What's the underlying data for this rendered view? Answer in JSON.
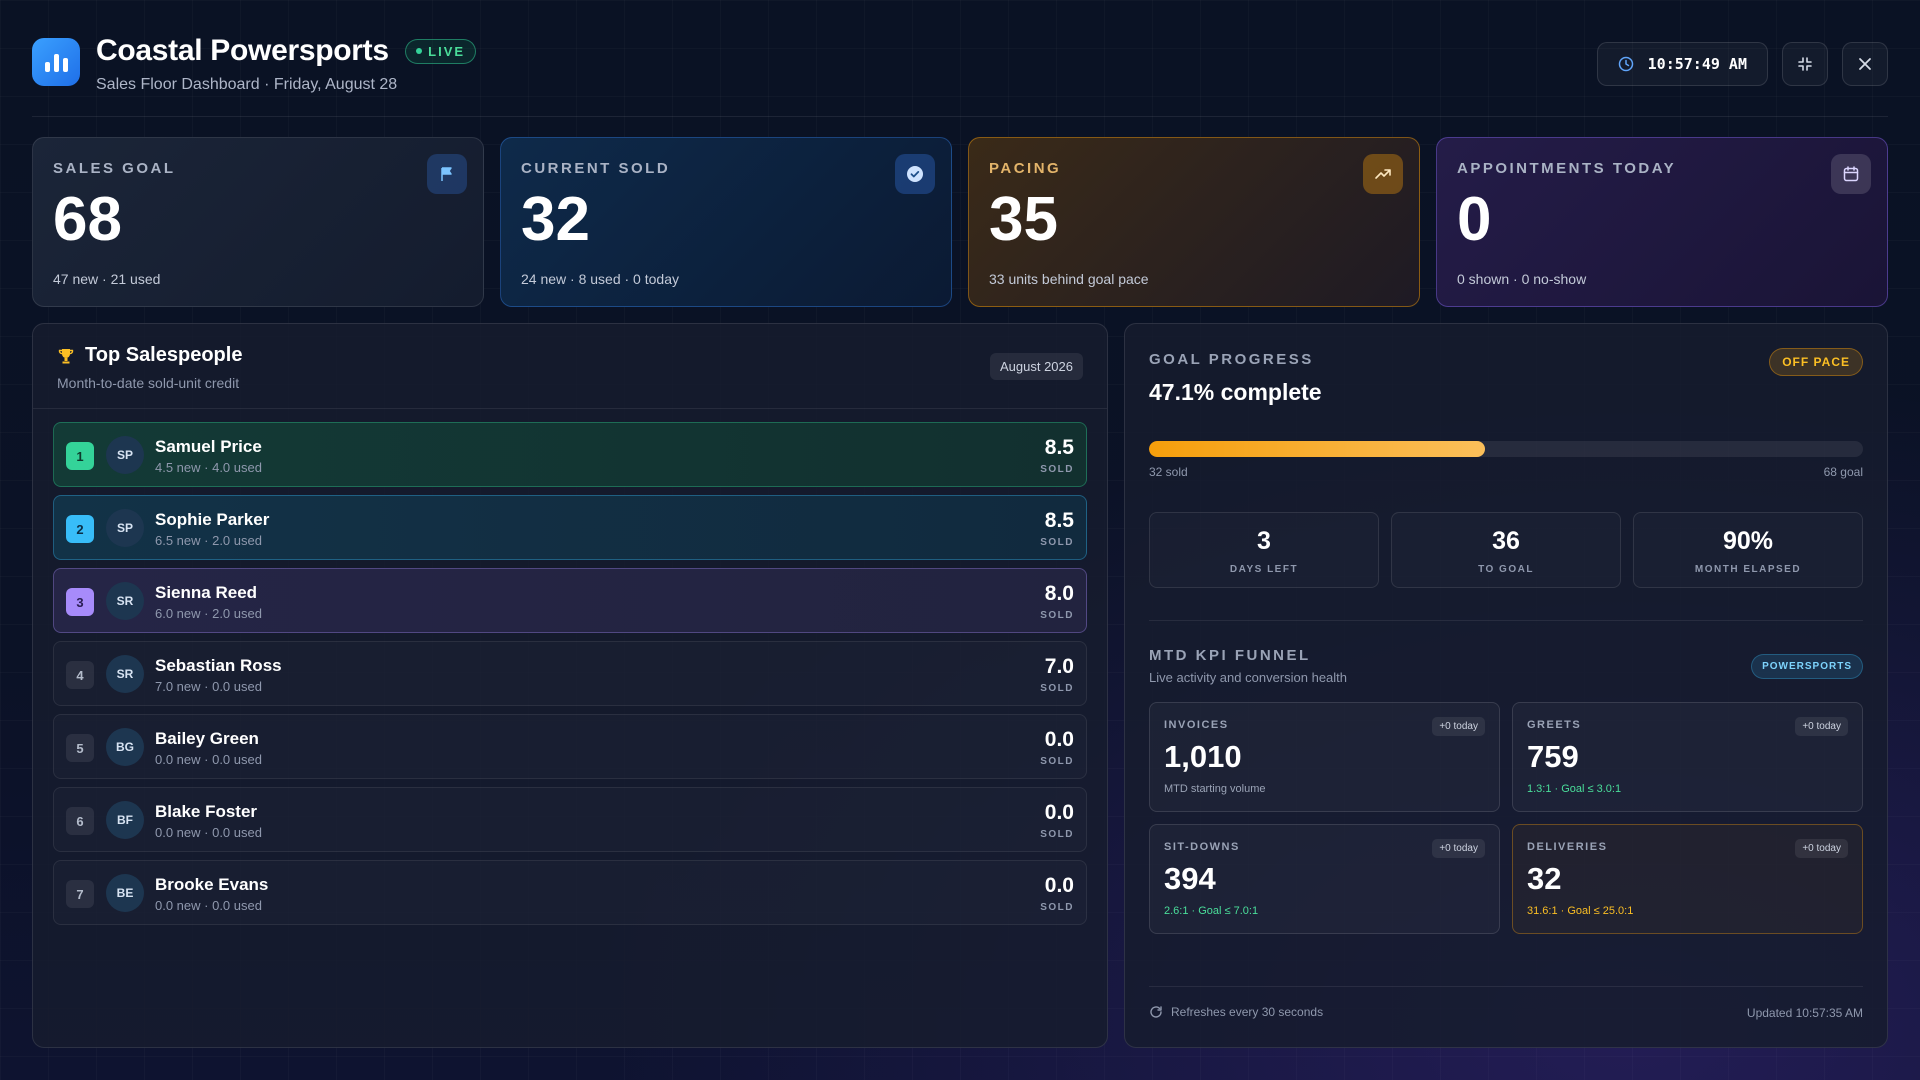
{
  "app": {
    "title": "Coastal Powersports",
    "live_label": "LIVE",
    "subtitle": "Sales Floor Dashboard · Friday, August 28",
    "clock": "10:57:49 AM"
  },
  "icons": {
    "logo": "bar-chart-icon",
    "clock": "clock-icon",
    "collapse": "collapse-icon",
    "close": "close-icon",
    "goal": "flag-icon",
    "sold": "check-circle-icon",
    "pacing": "trending-up-icon",
    "appointments": "calendar-icon",
    "salespeople": "trophy-icon",
    "refresh": "refresh-icon"
  },
  "colors": {
    "accent_blue": "#3aa0ff",
    "live_green": "#34d399",
    "pace_amber": "#f59e0b",
    "appt_purple": "#8b6cff"
  },
  "kpis": {
    "goal": {
      "label": "SALES GOAL",
      "value": "68",
      "sub": "47 new · 21 used"
    },
    "sold": {
      "label": "CURRENT SOLD",
      "value": "32",
      "sub": "24 new · 8 used · 0 today"
    },
    "pacing": {
      "label": "PACING",
      "value": "35",
      "sub": "33 units behind goal pace"
    },
    "appointments": {
      "label": "APPOINTMENTS TODAY",
      "value": "0",
      "sub": "0 shown · 0 no-show"
    }
  },
  "salespeople": {
    "title": "Top Salespeople",
    "subtitle": "Month-to-date sold-unit credit",
    "month": "August 2026",
    "sold_label": "SOLD",
    "rows": [
      {
        "rank": "1",
        "initials": "SP",
        "name": "Samuel Price",
        "detail": "4.5 new · 4.0 used",
        "value": "8.5"
      },
      {
        "rank": "2",
        "initials": "SP",
        "name": "Sophie Parker",
        "detail": "6.5 new · 2.0 used",
        "value": "8.5"
      },
      {
        "rank": "3",
        "initials": "SR",
        "name": "Sienna Reed",
        "detail": "6.0 new · 2.0 used",
        "value": "8.0"
      },
      {
        "rank": "4",
        "initials": "SR",
        "name": "Sebastian Ross",
        "detail": "7.0 new · 0.0 used",
        "value": "7.0"
      },
      {
        "rank": "5",
        "initials": "BG",
        "name": "Bailey Green",
        "detail": "0.0 new · 0.0 used",
        "value": "0.0"
      },
      {
        "rank": "6",
        "initials": "BF",
        "name": "Blake Foster",
        "detail": "0.0 new · 0.0 used",
        "value": "0.0"
      },
      {
        "rank": "7",
        "initials": "BE",
        "name": "Brooke Evans",
        "detail": "0.0 new · 0.0 used",
        "value": "0.0"
      }
    ]
  },
  "goal_progress": {
    "label": "GOAL PROGRESS",
    "title": "47.1% complete",
    "status": "OFF PACE",
    "progress_percent": 47.1,
    "left_caption": "32 sold",
    "right_caption": "68 goal",
    "stats": [
      {
        "value": "3",
        "label": "DAYS LEFT"
      },
      {
        "value": "36",
        "label": "TO GOAL"
      },
      {
        "value": "90%",
        "label": "MONTH ELAPSED"
      }
    ]
  },
  "funnel": {
    "label": "MTD KPI FUNNEL",
    "subtitle": "Live activity and conversion health",
    "chip": "POWERSPORTS",
    "cards": [
      {
        "label": "INVOICES",
        "value": "1,010",
        "note": "MTD starting volume",
        "today": "+0 today"
      },
      {
        "label": "GREETS",
        "value": "759",
        "note": "1.3:1 · Goal ≤ 3.0:1",
        "today": "+0 today"
      },
      {
        "label": "SIT-DOWNS",
        "value": "394",
        "note": "2.6:1 · Goal ≤ 7.0:1",
        "today": "+0 today"
      },
      {
        "label": "DELIVERIES",
        "value": "32",
        "note": "31.6:1 · Goal ≤ 25.0:1",
        "today": "+0 today"
      }
    ]
  },
  "footer": {
    "refresh": "Refreshes every 30 seconds",
    "updated": "Updated 10:57:35 AM"
  }
}
